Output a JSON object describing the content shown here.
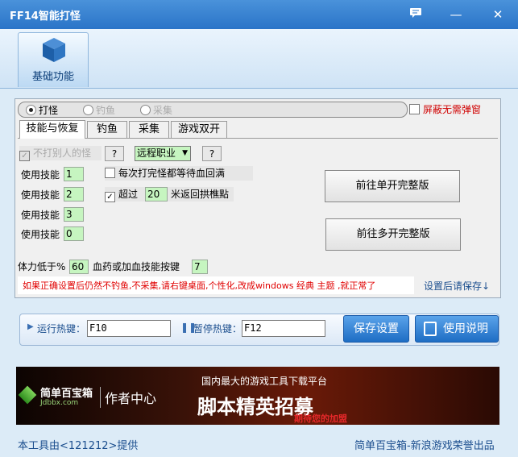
{
  "window": {
    "title": "FF14智能打怪"
  },
  "toolbar": {
    "basic_label": "基础功能"
  },
  "modes": [
    {
      "label": "打怪",
      "selected": true
    },
    {
      "label": "钓鱼",
      "selected": false
    },
    {
      "label": "采集",
      "selected": false
    }
  ],
  "disable_popup_label": "屏蔽无需弹窗",
  "tabs": [
    "技能与恢复",
    "钓鱼",
    "采集",
    "游戏双开"
  ],
  "skills": {
    "no_attack_label": "不打别人的怪",
    "help_label": "?",
    "job_select": "远程职业",
    "wait_hp_label": "每次打完怪都等待血回满",
    "over_label": "超过",
    "over_value": "20",
    "return_label": "米返回拱樵點",
    "use_skill_label": "使用技能",
    "skill_values": [
      "1",
      "2",
      "3",
      "0"
    ],
    "hp_low_label": "体力低于%",
    "hp_low_value": "60",
    "potion_label": "血药或加血技能按键",
    "potion_value": "7",
    "single_button": "前往单开完整版",
    "multi_button": "前往多开完整版"
  },
  "warning_text": "如果正确设置后仍然不钓鱼,不采集,请右键桌面,个性化,改成windows 经典 主题 ,就正常了",
  "save_hint": "设置后请保存↓",
  "hotkeys": {
    "run_label": "运行热键：",
    "run_value": "F10",
    "pause_label": "暂停热键：",
    "pause_value": "F12",
    "save_button": "保存设置",
    "help_button": "使用说明"
  },
  "banner": {
    "logo_name": "简单百宝箱",
    "logo_url": "Jdbbx.com",
    "author_center": "作者中心",
    "top_line": "国内最大的游戏工具下载平台",
    "big_line": "脚本精英招募",
    "sub_line": "期待您的加盟"
  },
  "footer": {
    "left": "本工具由<121212>提供",
    "right": "简单百宝箱-新浪游戏荣誉出品"
  }
}
